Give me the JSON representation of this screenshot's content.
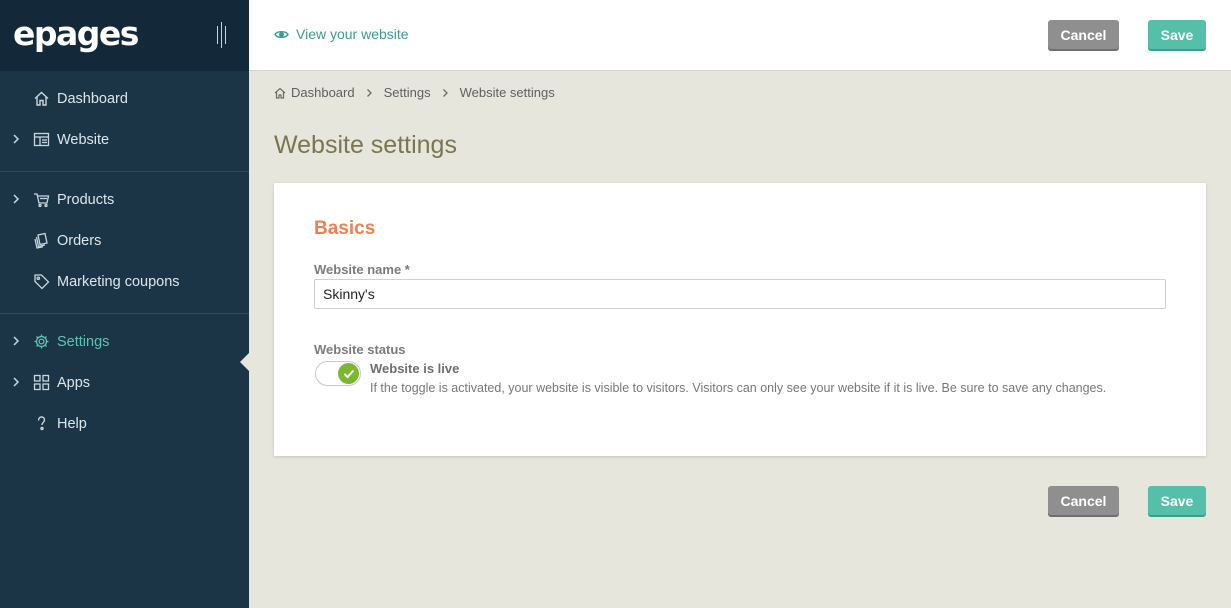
{
  "brand": {
    "logo_text": "epages"
  },
  "sidebar": {
    "groups": [
      [
        {
          "label": "Dashboard",
          "icon": "home-icon",
          "expandable": false
        },
        {
          "label": "Website",
          "icon": "layout-icon",
          "expandable": true
        }
      ],
      [
        {
          "label": "Products",
          "icon": "cart-icon",
          "expandable": true
        },
        {
          "label": "Orders",
          "icon": "orders-icon",
          "expandable": false
        },
        {
          "label": "Marketing coupons",
          "icon": "tag-icon",
          "expandable": false
        }
      ],
      [
        {
          "label": "Settings",
          "icon": "gear-icon",
          "expandable": true,
          "active": true
        },
        {
          "label": "Apps",
          "icon": "grid-icon",
          "expandable": true
        },
        {
          "label": "Help",
          "icon": "help-icon",
          "expandable": false
        }
      ]
    ]
  },
  "topbar": {
    "view_website_label": "View your website",
    "cancel_label": "Cancel",
    "save_label": "Save"
  },
  "breadcrumb": {
    "items": [
      "Dashboard",
      "Settings",
      "Website settings"
    ]
  },
  "page": {
    "title": "Website settings",
    "section_title": "Basics",
    "website_name_label": "Website name *",
    "website_name_value": "Skinny's",
    "website_status_label": "Website status",
    "toggle_label": "Website is live",
    "toggle_on": true,
    "toggle_help": "If the toggle is activated, your website is visible to visitors. Visitors can only see your website if it is live. Be sure to save any changes."
  },
  "footer_actions": {
    "cancel_label": "Cancel",
    "save_label": "Save"
  },
  "colors": {
    "sidebar_bg": "#1b3546",
    "accent_teal": "#55bfa9",
    "section_orange": "#ec8057",
    "toggle_green": "#7bb82f"
  }
}
